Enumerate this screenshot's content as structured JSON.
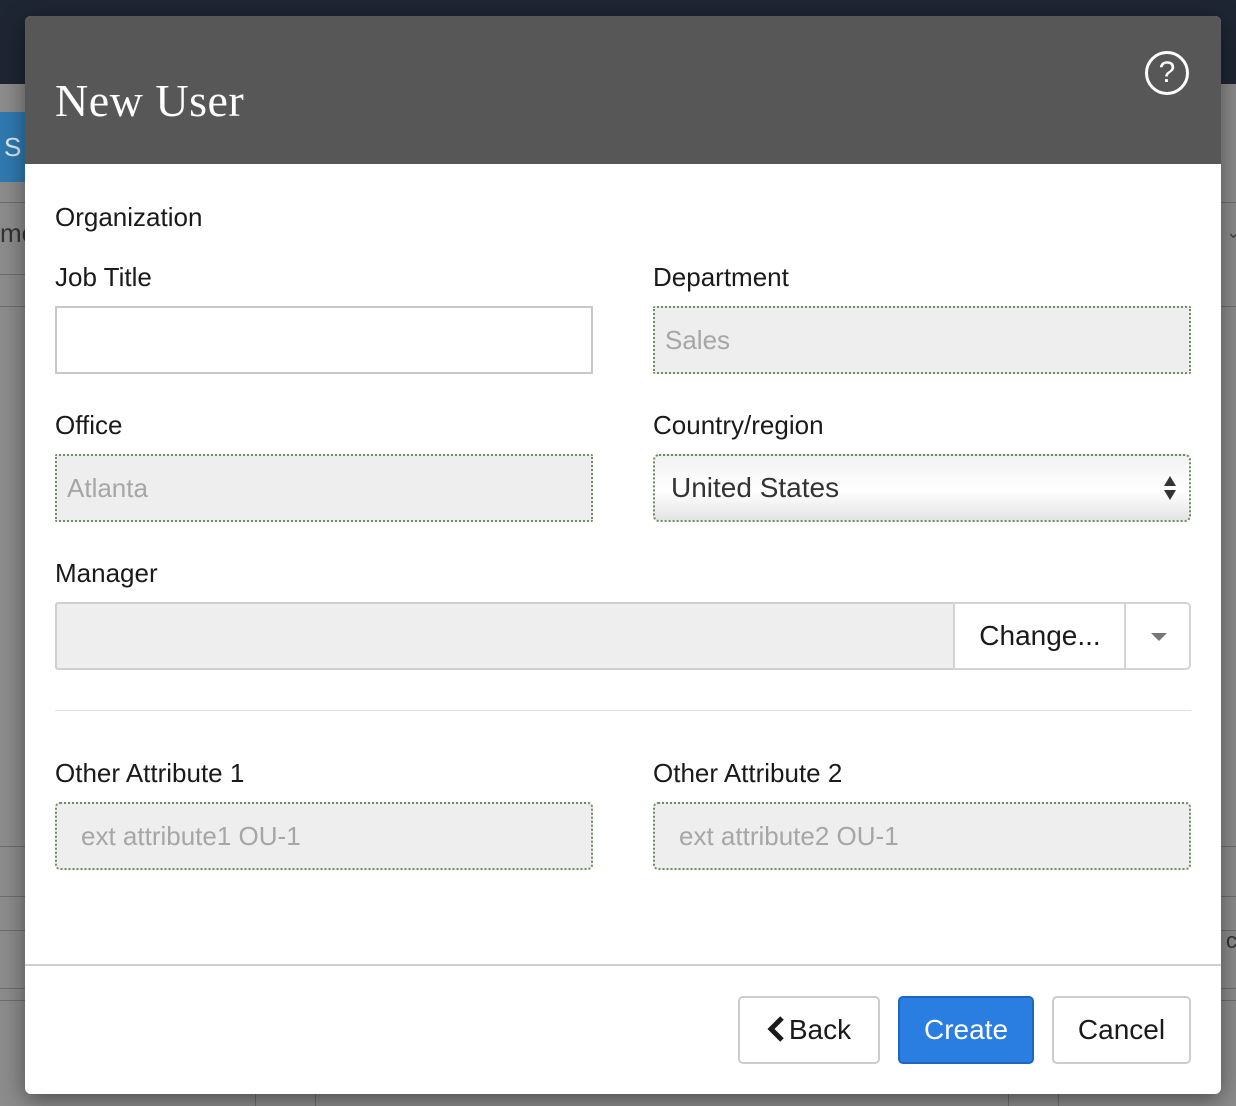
{
  "background": {
    "left_button_text": "S",
    "left_text": "me",
    "right_mark": "⌄",
    "right_char": "c"
  },
  "modal": {
    "title": "New User",
    "help_icon": "question-circle-icon",
    "help_glyph": "?"
  },
  "organization": {
    "section_title": "Organization",
    "job_title": {
      "label": "Job Title",
      "value": ""
    },
    "department": {
      "label": "Department",
      "value": "Sales"
    },
    "office": {
      "label": "Office",
      "value": "Atlanta"
    },
    "country": {
      "label": "Country/region",
      "value": "United States"
    },
    "manager": {
      "label": "Manager",
      "value": "",
      "change_label": "Change..."
    }
  },
  "other_attributes": {
    "attr1": {
      "label": "Other Attribute 1",
      "value": "ext attribute1 OU-1"
    },
    "attr2": {
      "label": "Other Attribute 2",
      "value": "ext attribute2 OU-1"
    }
  },
  "footer": {
    "back_label": "Back",
    "create_label": "Create",
    "cancel_label": "Cancel"
  },
  "colors": {
    "header_bg": "#575757",
    "primary_button": "#2a7de1",
    "readonly_bg": "#eeeeee",
    "readonly_border": "#6d8f5f"
  }
}
